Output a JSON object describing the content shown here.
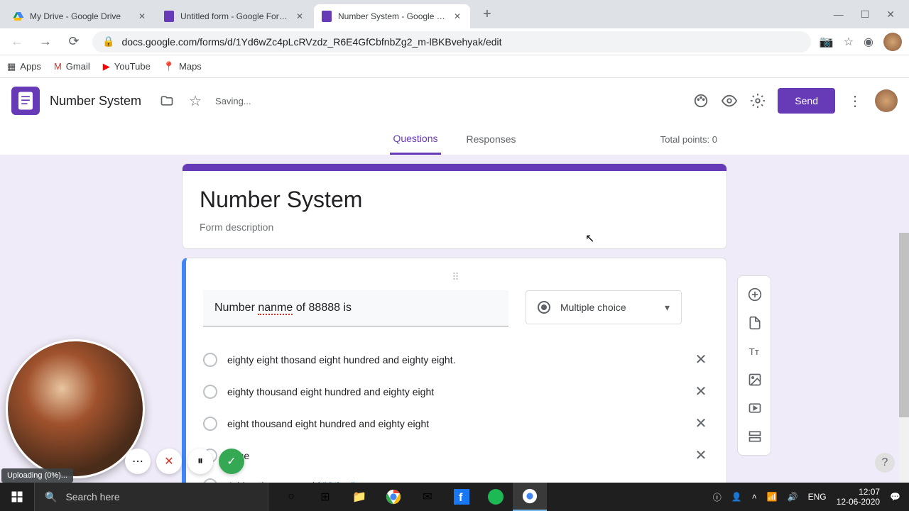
{
  "browser": {
    "tabs": [
      {
        "title": "My Drive - Google Drive",
        "favicon": "drive"
      },
      {
        "title": "Untitled form - Google Forms",
        "favicon": "forms"
      },
      {
        "title": "Number System - Google Forms",
        "favicon": "forms"
      }
    ],
    "url": "docs.google.com/forms/d/1Yd6wZc4pLcRVzdz_R6E4GfCbfnbZg2_m-lBKBvehyak/edit",
    "bookmarks": [
      {
        "label": "Apps",
        "icon": "apps"
      },
      {
        "label": "Gmail",
        "icon": "gmail"
      },
      {
        "label": "YouTube",
        "icon": "youtube"
      },
      {
        "label": "Maps",
        "icon": "maps"
      }
    ]
  },
  "header": {
    "title": "Number System",
    "status": "Saving...",
    "send": "Send"
  },
  "tabs": {
    "questions": "Questions",
    "responses": "Responses",
    "points": "Total points: 0"
  },
  "form": {
    "title": "Number System",
    "desc_placeholder": "Form description",
    "question": {
      "pre": "Number ",
      "mis": "nanme",
      "post": " of 88888 is",
      "type": "Multiple choice",
      "options": [
        "eighty eight thosand eight hundred and eighty eight.",
        "eighty thousand eight hundred and eighty eight",
        "eight thousand eight hundred and eighty eight",
        "none"
      ],
      "add_option": "Add option",
      "or": "  or  ",
      "add_other": "add \"Other\""
    }
  },
  "upload": "Uploading (0%)...",
  "taskbar": {
    "search_placeholder": "Search here",
    "lang": "ENG",
    "time": "12:07",
    "date": "12-06-2020"
  }
}
